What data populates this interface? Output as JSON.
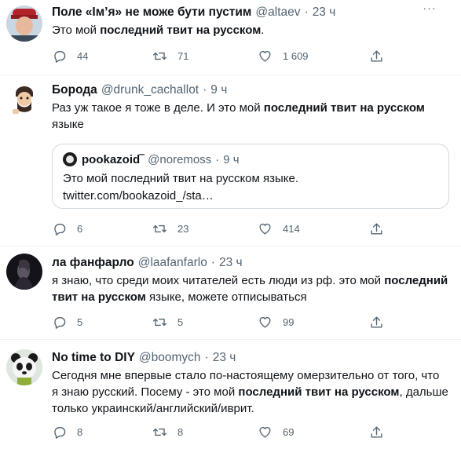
{
  "tweets": [
    {
      "name": "Поле «Ім’я» не може бути пустим",
      "handle": "@altaev",
      "dot": "·",
      "time": "23 ч",
      "text_before": "Это мой ",
      "text_bold": "последний твит на русском",
      "text_after": ".",
      "replies": "44",
      "retweets": "71",
      "likes": "1 609",
      "avatar_icon": "avatar-red-cap-photo"
    },
    {
      "name": "Борода",
      "handle": "@drunk_cachallot",
      "dot": "·",
      "time": "9 ч",
      "text_before": "Раз уж такое я тоже в деле. И это мой ",
      "text_bold": "последний твит на русском",
      "text_after": " языке",
      "replies": "6",
      "retweets": "23",
      "likes": "414",
      "avatar_icon": "avatar-bearded-cartoon",
      "quote": {
        "name": "pookazoid‾",
        "handle": "@noremoss",
        "dot": "·",
        "time": "9 ч",
        "line1": "Это мой последний твит на русском языке.",
        "line2": "twitter.com/bookazoid_/sta…"
      }
    },
    {
      "name": "ла фанфарло",
      "handle": "@laafanfarlo",
      "dot": "·",
      "time": "23 ч",
      "text_before": "я знаю, что среди моих читателей есть люди из рф. это мой ",
      "text_bold": "последний твит на русском",
      "text_after": " языке, можете отписываться",
      "replies": "5",
      "retweets": "5",
      "likes": "99",
      "avatar_icon": "avatar-dark-portrait"
    },
    {
      "name": "No time to DIY",
      "handle": "@boomych",
      "dot": "·",
      "time": "23 ч",
      "text_before": "Сегодня мне впервые стало по-настоящему омерзительно от того, что я знаю русский.  Посему - это мой ",
      "text_bold": "последний твит на русском",
      "text_after": ", дальше только украинский/английский/иврит.",
      "replies": "8",
      "retweets": "8",
      "likes": "69",
      "avatar_icon": "avatar-panda"
    }
  ],
  "more_label": "···",
  "colors": {
    "text": "#0f1419",
    "muted": "#536471",
    "divider": "#eff3f4",
    "quote_border": "#cfd9de"
  }
}
